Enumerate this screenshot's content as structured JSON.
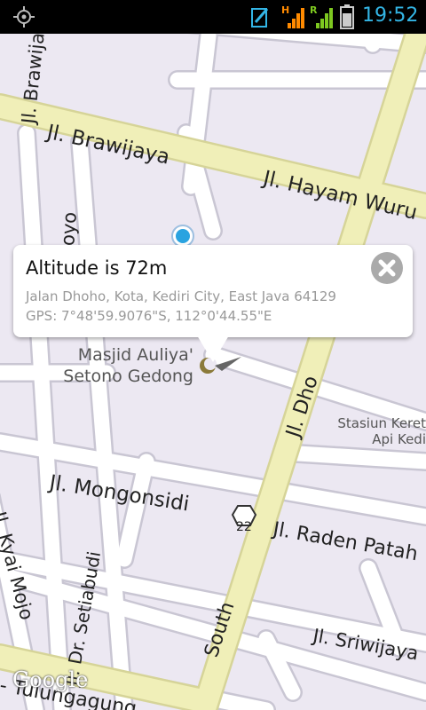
{
  "status_bar": {
    "time": "19:52",
    "net_h": "H",
    "net_r": "R",
    "icons": [
      "gps-icon",
      "edit-note-icon",
      "signal-h-icon",
      "signal-r-icon",
      "battery-icon"
    ]
  },
  "map": {
    "streets": {
      "brawijaya": "Jl. Brawijaya",
      "brawijaya_vertical": "Jl. Brawija",
      "hayam_wuruk": "Jl. Hayam Wuru",
      "nojoyo": "nojoyo",
      "mongonsidi": "Jl. Mongonsidi",
      "raden_patah": "Jl. Raden Patah",
      "kyai_mojo": "Jl. Kyai Mojo",
      "setiabudi": "Jl. Dr. Setiabudi",
      "sriwijaya": "Jl. Sriwijaya",
      "tulungagung": "- Tulungagung",
      "south": "South",
      "dhoho": "Jl. Dho"
    },
    "poi": {
      "masjid_line1": "Masjid Auliya'",
      "masjid_line2": "Setono Gedong",
      "stasiun_line1": "Stasiun Keret",
      "stasiun_line2": "Api Kedi"
    },
    "route_shield": "22",
    "google_logo": "Google",
    "colors": {
      "background": "#ece8f2",
      "road": "#ffffff",
      "road_outline": "#c9c6d3",
      "main_road": "#f0efb8",
      "main_road_outline": "#d6d498"
    }
  },
  "info_window": {
    "title": "Altitude is 72m",
    "address": "Jalan Dhoho, Kota, Kediri City, East Java 64129",
    "gps": "GPS: 7°48'59.9076\"S, 112°0'44.55\"E",
    "close_icon": "close-icon"
  }
}
